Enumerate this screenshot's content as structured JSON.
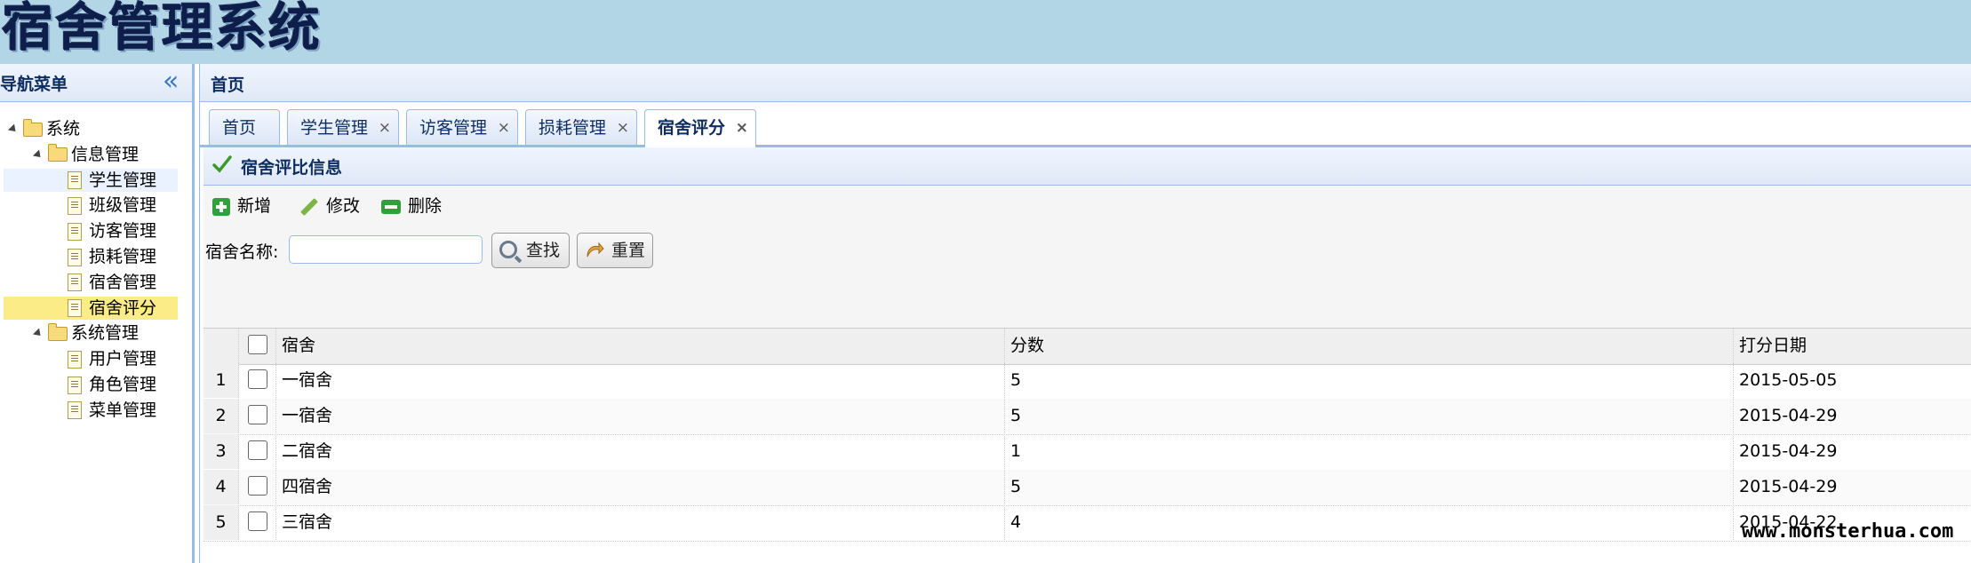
{
  "app": {
    "title": "宿舍管理系统"
  },
  "sidebar": {
    "title": "导航菜单",
    "collapse_icon": "double-chevron-left-icon",
    "tree": [
      {
        "label": "系统",
        "type": "folder",
        "level": 0
      },
      {
        "label": "信息管理",
        "type": "folder",
        "level": 1
      },
      {
        "label": "学生管理",
        "type": "file",
        "level": 2
      },
      {
        "label": "班级管理",
        "type": "file",
        "level": 2
      },
      {
        "label": "访客管理",
        "type": "file",
        "level": 2
      },
      {
        "label": "损耗管理",
        "type": "file",
        "level": 2
      },
      {
        "label": "宿舍管理",
        "type": "file",
        "level": 2
      },
      {
        "label": "宿舍评分",
        "type": "file",
        "level": 2,
        "selected": true
      },
      {
        "label": "系统管理",
        "type": "folder",
        "level": 1
      },
      {
        "label": "用户管理",
        "type": "file",
        "level": 2
      },
      {
        "label": "角色管理",
        "type": "file",
        "level": 2
      },
      {
        "label": "菜单管理",
        "type": "file",
        "level": 2
      }
    ]
  },
  "main": {
    "title": "首页",
    "tabs": [
      {
        "label": "首页",
        "closable": false
      },
      {
        "label": "学生管理",
        "closable": true
      },
      {
        "label": "访客管理",
        "closable": true
      },
      {
        "label": "损耗管理",
        "closable": true
      },
      {
        "label": "宿舍评分",
        "closable": true,
        "active": true
      }
    ],
    "close_glyph": "×"
  },
  "panel": {
    "title": "宿舍评比信息",
    "toolbar": {
      "add": "新增",
      "edit": "修改",
      "delete": "删除"
    },
    "search": {
      "label": "宿舍名称:",
      "value": "",
      "find": "查找",
      "reset": "重置"
    }
  },
  "grid": {
    "columns": [
      "宿舍",
      "分数",
      "打分日期"
    ],
    "rows": [
      {
        "n": "1",
        "dorm": "一宿舍",
        "score": "5",
        "date": "2015-05-05"
      },
      {
        "n": "2",
        "dorm": "一宿舍",
        "score": "5",
        "date": "2015-04-29"
      },
      {
        "n": "3",
        "dorm": "二宿舍",
        "score": "1",
        "date": "2015-04-29"
      },
      {
        "n": "4",
        "dorm": "四宿舍",
        "score": "5",
        "date": "2015-04-29"
      },
      {
        "n": "5",
        "dorm": "三宿舍",
        "score": "4",
        "date": "2015-04-22"
      }
    ]
  },
  "watermark": "www.monsterhua.com"
}
